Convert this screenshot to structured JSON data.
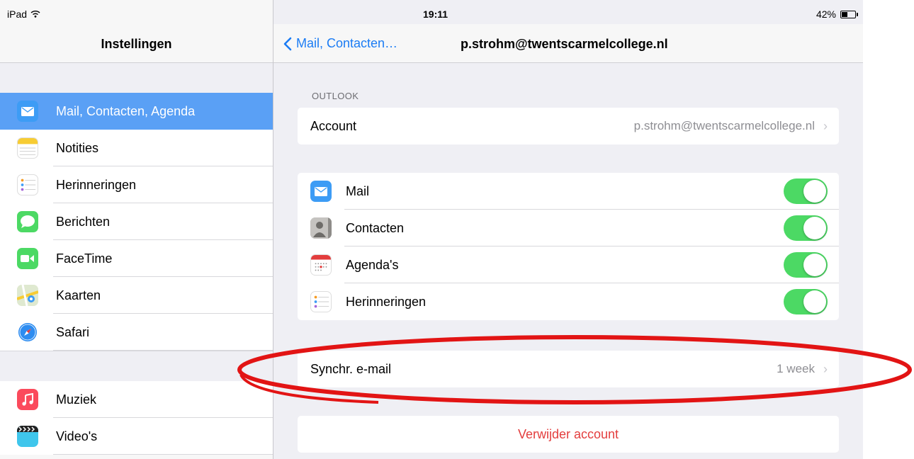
{
  "status_bar": {
    "device": "iPad",
    "time": "19:11",
    "battery": "42%"
  },
  "sidebar": {
    "title": "Instellingen",
    "group1": [
      {
        "label": "Mail, Contacten, Agenda",
        "icon": "mail-icon",
        "selected": true
      },
      {
        "label": "Notities",
        "icon": "notes-icon"
      },
      {
        "label": "Herinneringen",
        "icon": "reminders-icon"
      },
      {
        "label": "Berichten",
        "icon": "messages-icon"
      },
      {
        "label": "FaceTime",
        "icon": "facetime-icon"
      },
      {
        "label": "Kaarten",
        "icon": "maps-icon"
      },
      {
        "label": "Safari",
        "icon": "safari-icon"
      }
    ],
    "group2": [
      {
        "label": "Muziek",
        "icon": "music-icon"
      },
      {
        "label": "Video's",
        "icon": "videos-icon"
      }
    ]
  },
  "detail": {
    "back_label": "Mail, Contacten…",
    "title": "p.strohm@twentscarmelcollege.nl",
    "section_header": "OUTLOOK",
    "account": {
      "label": "Account",
      "value": "p.strohm@twentscarmelcollege.nl"
    },
    "toggles": [
      {
        "label": "Mail",
        "icon": "mail-icon",
        "on": true
      },
      {
        "label": "Contacten",
        "icon": "contacts-icon",
        "on": true
      },
      {
        "label": "Agenda's",
        "icon": "calendar-icon",
        "on": true
      },
      {
        "label": "Herinneringen",
        "icon": "reminders-icon",
        "on": true
      }
    ],
    "sync": {
      "label": "Synchr. e-mail",
      "value": "1 week"
    },
    "delete_label": "Verwijder account"
  },
  "colors": {
    "accent": "#1b7cf4",
    "selected_row": "#5aa0f5",
    "toggle_on": "#4cd964",
    "destructive": "#e33d3d",
    "highlight_ring": "#e21414"
  }
}
